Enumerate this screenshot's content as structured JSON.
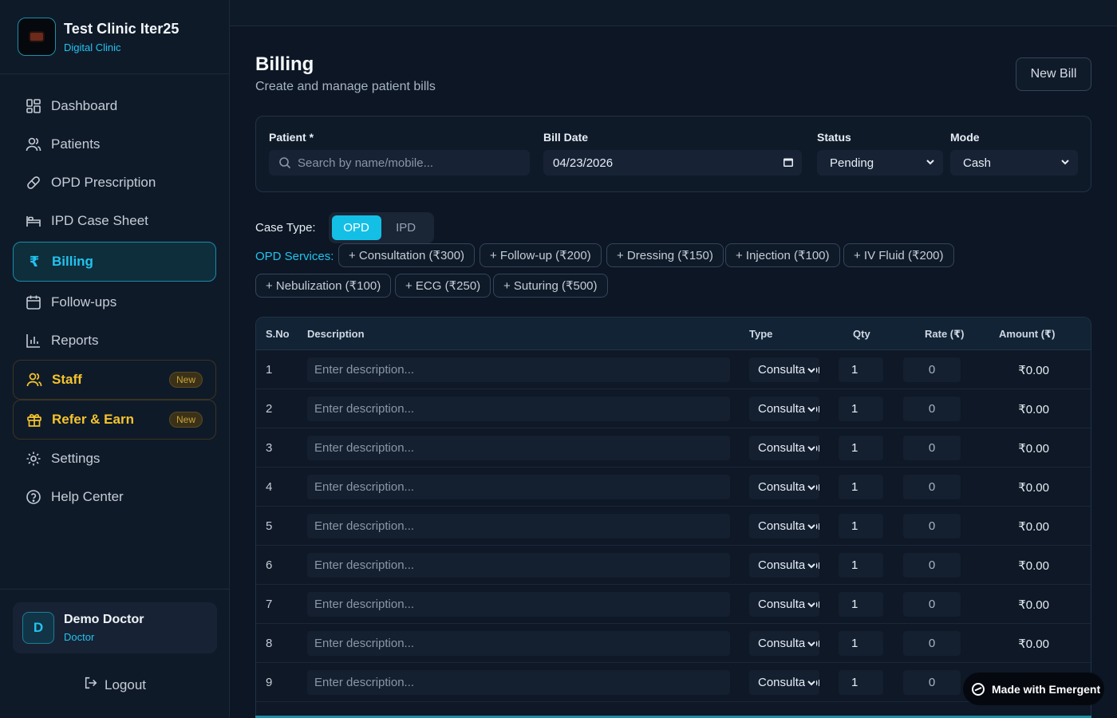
{
  "brand": {
    "title": "Test Clinic Iter25",
    "subtitle": "Digital Clinic"
  },
  "nav": [
    {
      "label": "Dashboard",
      "icon": "dashboard-icon"
    },
    {
      "label": "Patients",
      "icon": "users-icon"
    },
    {
      "label": "OPD Prescription",
      "icon": "pill-icon"
    },
    {
      "label": "IPD Case Sheet",
      "icon": "bed-icon"
    },
    {
      "label": "Billing",
      "icon": "rupee-icon",
      "active": true
    },
    {
      "label": "Follow-ups",
      "icon": "calendar-icon"
    },
    {
      "label": "Reports",
      "icon": "chart-icon"
    },
    {
      "label": "Staff",
      "icon": "staff-icon",
      "badge": "New"
    },
    {
      "label": "Refer & Earn",
      "icon": "gift-icon",
      "badge": "New"
    },
    {
      "label": "Settings",
      "icon": "gear-icon"
    },
    {
      "label": "Help Center",
      "icon": "help-icon"
    }
  ],
  "user": {
    "initial": "D",
    "name": "Demo Doctor",
    "role": "Doctor",
    "logout_label": "Logout"
  },
  "page": {
    "title": "Billing",
    "subtitle": "Create and manage patient bills",
    "new_bill_label": "New Bill"
  },
  "form": {
    "patient_label": "Patient *",
    "patient_placeholder": "Search by name/mobile...",
    "date_label": "Bill Date",
    "date_value": "04/23/2026",
    "status_label": "Status",
    "status_value": "Pending",
    "mode_label": "Mode",
    "mode_value": "Cash"
  },
  "case_type": {
    "label": "Case Type:",
    "options": [
      "OPD",
      "IPD"
    ],
    "selected": "OPD"
  },
  "services": {
    "label": "OPD Services:",
    "items": [
      "+ Consultation (₹300)",
      "+ Follow-up (₹200)",
      "+ Dressing (₹150)",
      "+ Injection (₹100)",
      "+ IV Fluid (₹200)",
      "+ Nebulization (₹100)",
      "+ ECG (₹250)",
      "+ Suturing (₹500)"
    ]
  },
  "table": {
    "headers": {
      "sno": "S.No",
      "description": "Description",
      "type": "Type",
      "qty": "Qty",
      "rate": "Rate (₹)",
      "amount": "Amount (₹)"
    },
    "description_placeholder": "Enter description...",
    "rows": [
      {
        "sno": "1",
        "type": "Consultation",
        "qty": "1",
        "rate": "0",
        "amount": "₹0.00"
      },
      {
        "sno": "2",
        "type": "Consultation",
        "qty": "1",
        "rate": "0",
        "amount": "₹0.00"
      },
      {
        "sno": "3",
        "type": "Consultation",
        "qty": "1",
        "rate": "0",
        "amount": "₹0.00"
      },
      {
        "sno": "4",
        "type": "Consultation",
        "qty": "1",
        "rate": "0",
        "amount": "₹0.00"
      },
      {
        "sno": "5",
        "type": "Consultation",
        "qty": "1",
        "rate": "0",
        "amount": "₹0.00"
      },
      {
        "sno": "6",
        "type": "Consultation",
        "qty": "1",
        "rate": "0",
        "amount": "₹0.00"
      },
      {
        "sno": "7",
        "type": "Consultation",
        "qty": "1",
        "rate": "0",
        "amount": "₹0.00"
      },
      {
        "sno": "8",
        "type": "Consultation",
        "qty": "1",
        "rate": "0",
        "amount": "₹0.00"
      },
      {
        "sno": "9",
        "type": "Consultation",
        "qty": "1",
        "rate": "0",
        "amount": ""
      }
    ]
  },
  "footer_badge": "Made with Emergent",
  "colors": {
    "accent": "#22c3ee",
    "promo": "#f5c42c",
    "background": "#0c1624"
  }
}
